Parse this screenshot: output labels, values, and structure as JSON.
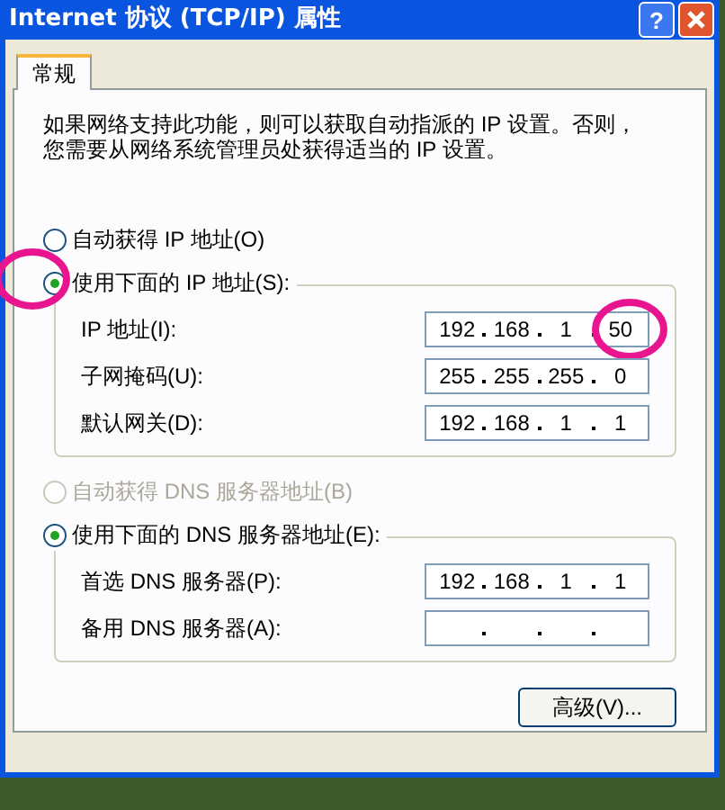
{
  "window": {
    "title": "Internet 协议 (TCP/IP) 属性",
    "help_button": "?"
  },
  "tabs": [
    {
      "label": "常规",
      "selected": true
    }
  ],
  "description": "如果网络支持此功能，则可以获取自动指派的 IP 设置。否则，您需要从网络系统管理员处获得适当的 IP 设置。",
  "ip_mode": [
    {
      "label": "自动获得 IP 地址(O)",
      "selected": false,
      "disabled": false
    },
    {
      "label": "使用下面的 IP 地址(S):",
      "selected": true,
      "disabled": false,
      "circled": true
    }
  ],
  "ip_fields": [
    {
      "label": "IP 地址(I):",
      "octets": [
        "192",
        "168",
        "1",
        "50"
      ],
      "circled": true
    },
    {
      "label": "子网掩码(U):",
      "octets": [
        "255",
        "255",
        "255",
        "0"
      ]
    },
    {
      "label": "默认网关(D):",
      "octets": [
        "192",
        "168",
        "1",
        "1"
      ]
    }
  ],
  "dns_mode": [
    {
      "label": "自动获得 DNS 服务器地址(B)",
      "selected": false,
      "disabled": true
    },
    {
      "label": "使用下面的 DNS 服务器地址(E):",
      "selected": true,
      "disabled": false
    }
  ],
  "dns_fields": [
    {
      "label": "首选 DNS 服务器(P):",
      "octets": [
        "192",
        "168",
        "1",
        "1"
      ]
    },
    {
      "label": "备用 DNS 服务器(A):"
    }
  ],
  "buttons": [
    "高级(V)..."
  ]
}
